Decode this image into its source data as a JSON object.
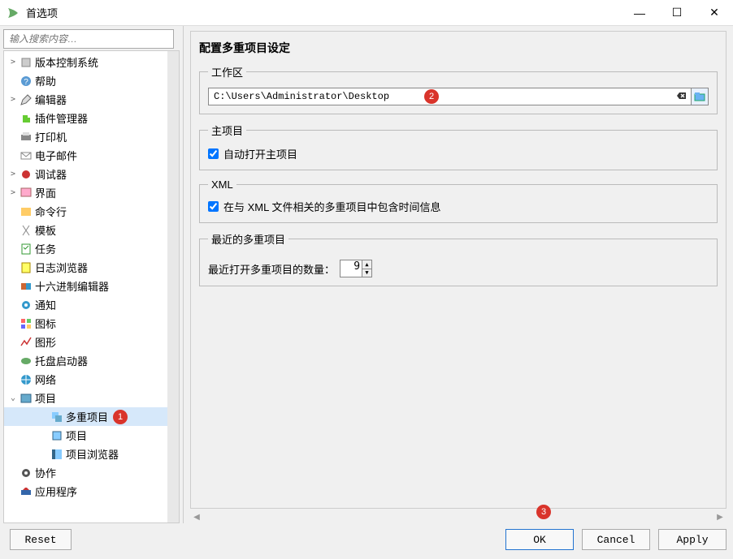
{
  "window": {
    "title": "首选项",
    "min": "—",
    "max": "☐",
    "close": "✕"
  },
  "search": {
    "placeholder": "输入搜索内容…"
  },
  "tree": [
    {
      "label": "版本控制系统",
      "expandable": true,
      "icon": "vcs",
      "level": 0
    },
    {
      "label": "帮助",
      "expandable": false,
      "icon": "help",
      "level": 0
    },
    {
      "label": "编辑器",
      "expandable": true,
      "icon": "editor",
      "level": 0
    },
    {
      "label": "插件管理器",
      "expandable": false,
      "icon": "plugin",
      "level": 0
    },
    {
      "label": "打印机",
      "expandable": false,
      "icon": "printer",
      "level": 0
    },
    {
      "label": "电子邮件",
      "expandable": false,
      "icon": "mail",
      "level": 0
    },
    {
      "label": "调试器",
      "expandable": true,
      "icon": "debug",
      "level": 0
    },
    {
      "label": "界面",
      "expandable": true,
      "icon": "ui",
      "level": 0
    },
    {
      "label": "命令行",
      "expandable": false,
      "icon": "cmd",
      "level": 0
    },
    {
      "label": "模板",
      "expandable": false,
      "icon": "template",
      "level": 0
    },
    {
      "label": "任务",
      "expandable": false,
      "icon": "tasks",
      "level": 0
    },
    {
      "label": "日志浏览器",
      "expandable": false,
      "icon": "log",
      "level": 0
    },
    {
      "label": "十六进制编辑器",
      "expandable": false,
      "icon": "hex",
      "level": 0
    },
    {
      "label": "通知",
      "expandable": false,
      "icon": "notif",
      "level": 0
    },
    {
      "label": "图标",
      "expandable": false,
      "icon": "icons",
      "level": 0
    },
    {
      "label": "图形",
      "expandable": false,
      "icon": "graphics",
      "level": 0
    },
    {
      "label": "托盘启动器",
      "expandable": false,
      "icon": "tray",
      "level": 0
    },
    {
      "label": "网络",
      "expandable": false,
      "icon": "net",
      "level": 0
    },
    {
      "label": "项目",
      "expandable": true,
      "expanded": true,
      "icon": "project",
      "level": 0
    },
    {
      "label": "多重项目",
      "expandable": false,
      "icon": "mult",
      "level": 1,
      "selected": true,
      "badge": "1"
    },
    {
      "label": "项目",
      "expandable": false,
      "icon": "projchild",
      "level": 1
    },
    {
      "label": "项目浏览器",
      "expandable": false,
      "icon": "projbrowser",
      "level": 1
    },
    {
      "label": "协作",
      "expandable": false,
      "icon": "collab",
      "level": 0
    },
    {
      "label": "应用程序",
      "expandable": false,
      "icon": "apps",
      "level": 0
    }
  ],
  "page": {
    "heading": "配置多重项目设定",
    "workspace": {
      "legend": "工作区",
      "path": "C:\\Users\\Administrator\\Desktop",
      "badge": "2"
    },
    "mainproject": {
      "legend": "主项目",
      "checkbox": "自动打开主项目",
      "checked": true
    },
    "xml": {
      "legend": "XML",
      "checkbox": "在与 XML 文件相关的多重项目中包含时间信息",
      "checked": true
    },
    "recent": {
      "legend": "最近的多重项目",
      "label": "最近打开多重项目的数量：",
      "value": "9"
    },
    "footer_badge": "3"
  },
  "footer": {
    "reset": "Reset",
    "ok": "OK",
    "cancel": "Cancel",
    "apply": "Apply"
  }
}
